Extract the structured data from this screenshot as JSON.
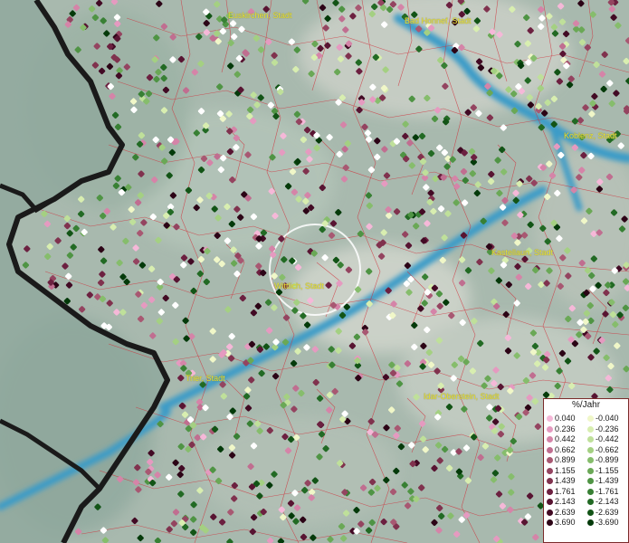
{
  "cities": [
    {
      "name": "Euskirchen, Stadt"
    },
    {
      "name": "Bad Honnef, Stadt"
    },
    {
      "name": "Koblenz, Stadt"
    },
    {
      "name": "Kastellaun, Stadt"
    },
    {
      "name": "Wittlich, Stadt"
    },
    {
      "name": "Trier, Stadt"
    },
    {
      "name": "Idar-Oberstein, Stadt"
    }
  ],
  "legend": {
    "title": "%/Jahr",
    "positive": [
      "0.040",
      "0.236",
      "0.442",
      "0.662",
      "0.899",
      "1.155",
      "1.439",
      "1.761",
      "2.143",
      "2.639",
      "3.690"
    ],
    "negative": [
      "-0.040",
      "-0.236",
      "-0.442",
      "-0.662",
      "-0.899",
      "-1.155",
      "-1.439",
      "-1.761",
      "-2.143",
      "-2.639",
      "-3.690"
    ],
    "positive_colors": [
      "#f5b8d8",
      "#e59ac0",
      "#d584a8",
      "#c06e90",
      "#a85872",
      "#944460",
      "#80324e",
      "#6c2040",
      "#581432",
      "#420a24",
      "#2c0416"
    ],
    "negative_colors": [
      "#f0f7c8",
      "#d8eeb0",
      "#bfe09a",
      "#a4d082",
      "#86bd6c",
      "#6aa856",
      "#4f9444",
      "#388034",
      "#226a24",
      "#125416",
      "#043a0a"
    ]
  }
}
